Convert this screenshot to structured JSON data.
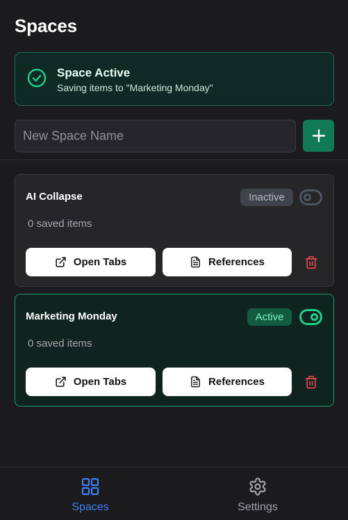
{
  "header": {
    "title": "Spaces"
  },
  "banner": {
    "title": "Space Active",
    "subtitle": "Saving items to \"Marketing Monday\"",
    "icon": "check-circle-icon"
  },
  "new_space": {
    "placeholder": "New Space Name",
    "value": "",
    "add_icon": "plus-icon"
  },
  "spaces": [
    {
      "name": "AI Collapse",
      "count_text": "0 saved items",
      "status": "Inactive",
      "enabled": false,
      "open_tabs_label": "Open Tabs",
      "references_label": "References"
    },
    {
      "name": "Marketing Monday",
      "count_text": "0 saved items",
      "status": "Active",
      "enabled": true,
      "open_tabs_label": "Open Tabs",
      "references_label": "References"
    }
  ],
  "nav": {
    "spaces_label": "Spaces",
    "settings_label": "Settings"
  },
  "colors": {
    "accent_green": "#0f7a55",
    "active_green": "#1fcf8c",
    "nav_active": "#3f7ff5",
    "danger": "#e5484d"
  }
}
